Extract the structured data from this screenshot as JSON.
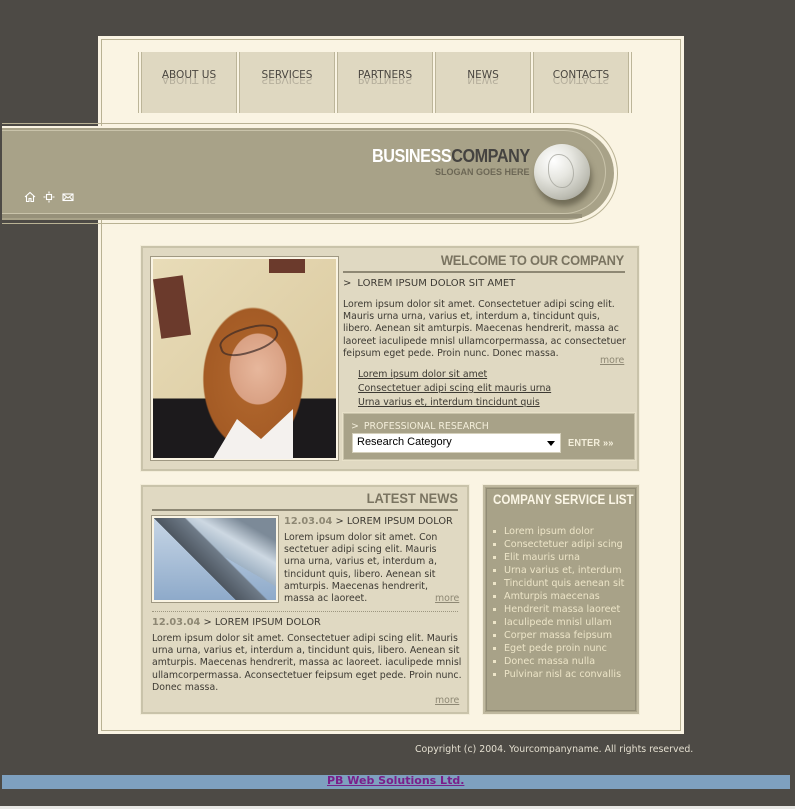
{
  "nav": {
    "items": [
      {
        "label": "ABOUT US"
      },
      {
        "label": "SERVICES"
      },
      {
        "label": "PARTNERS"
      },
      {
        "label": "NEWS"
      },
      {
        "label": "CONTACTS"
      }
    ]
  },
  "header": {
    "brand_part1": "BUSINESS",
    "brand_part2": "COMPANY",
    "slogan": "SLOGAN GOES HERE",
    "icons": [
      "home-icon",
      "sitemap-icon",
      "mail-icon"
    ]
  },
  "welcome": {
    "title": "WELCOME TO OUR COMPANY",
    "subheading": "LOREM IPSUM DOLOR SIT AMET",
    "body": "Lorem ipsum dolor sit amet. Consectetuer adipi scing elit. Mauris urna urna, varius et, interdum a, tincidunt quis, libero. Aenean sit amturpis. Maecenas hendrerit, massa ac laoreet iaculipede mnisl ullamcorpermassa, ac consectetuer feipsum eget pede. Proin nunc. Donec massa.",
    "more": "more",
    "links": [
      "Lorem ipsum dolor sit amet",
      "Consectetuer adipi scing elit mauris urna",
      "Urna varius et, interdum tincidunt quis"
    ]
  },
  "research": {
    "label": "PROFESSIONAL RESEARCH",
    "select_value": "Research Category",
    "enter_label": "ENTER »»"
  },
  "news": {
    "title": "LATEST NEWS",
    "items": [
      {
        "date": "12.03.04",
        "headline": "LOREM IPSUM DOLOR",
        "body": "Lorem ipsum dolor sit amet. Con sectetuer adipi scing elit. Mauris urna urna, varius et, interdum a, tincidunt quis, libero. Aenean sit amturpis. Maecenas hendrerit, massa ac laoreet.",
        "more": "more"
      },
      {
        "date": "12.03.04",
        "headline": "LOREM IPSUM DOLOR",
        "body": "Lorem ipsum dolor sit amet. Consectetuer adipi scing elit. Mauris urna urna, varius et, interdum a, tincidunt quis, libero. Aenean sit amturpis. Maecenas hendrerit, massa ac laoreet. iaculipede mnisl ullamcorpermassa. Aconsectetuer feipsum eget pede. Proin nunc. Donec massa.",
        "more": "more"
      }
    ]
  },
  "services": {
    "title": "COMPANY SERVICE LIST",
    "items": [
      "Lorem ipsum dolor",
      "Consectetuer adipi scing",
      "Elit mauris urna",
      "Urna varius et, interdum",
      "Tincidunt quis aenean sit",
      "Amturpis maecenas",
      "Hendrerit massa laoreet",
      "Iaculipede mnisl ullam",
      "Corper massa feipsum",
      "Eget pede proin nunc",
      "Donec massa nulla",
      "Pulvinar nisl ac convallis"
    ]
  },
  "footer": {
    "copyright": "Copyright (c) 2004. Yourcompanyname. All rights reserved.",
    "credit_link": "PB Web Solutions Ltd."
  },
  "colors": {
    "page_bg": "#4d4a45",
    "panel_bg": "#faf4e3",
    "box_bg": "#e0d9c2",
    "accent_khaki": "#a8a288",
    "credit_bar": "#7ea0bf",
    "credit_link": "#7a1f8a"
  }
}
